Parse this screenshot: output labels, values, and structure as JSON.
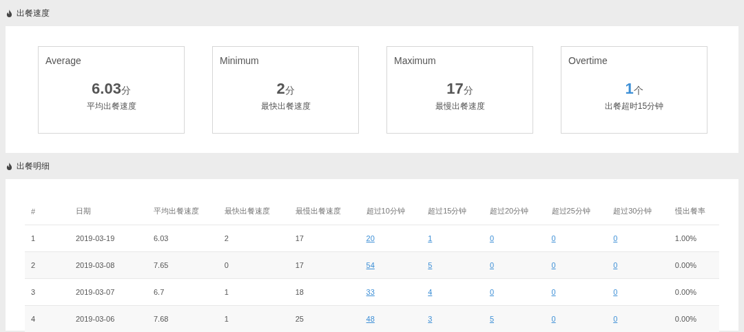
{
  "sections": [
    {
      "title": "出餐速度"
    },
    {
      "title": "出餐明细"
    }
  ],
  "stats": [
    {
      "label": "Average",
      "value": "6.03",
      "unit": "分",
      "caption": "平均出餐速度",
      "highlight": false
    },
    {
      "label": "Minimum",
      "value": "2",
      "unit": "分",
      "caption": "最快出餐速度",
      "highlight": false
    },
    {
      "label": "Maximum",
      "value": "17",
      "unit": "分",
      "caption": "最慢出餐速度",
      "highlight": false
    },
    {
      "label": "Overtime",
      "value": "1",
      "unit": "个",
      "caption": "出餐超时15分钟",
      "highlight": true
    }
  ],
  "table": {
    "columns": [
      "#",
      "日期",
      "平均出餐速度",
      "最快出餐速度",
      "最慢出餐速度",
      "超过10分钟",
      "超过15分钟",
      "超过20分钟",
      "超过25分钟",
      "超过30分钟",
      "慢出餐率"
    ],
    "rows": [
      {
        "index": "1",
        "date": "2019-03-19",
        "avg": "6.03",
        "fastest": "2",
        "slowest": "17",
        "over": [
          "20",
          "1",
          "0",
          "0",
          "0"
        ],
        "rate": "1.00%"
      },
      {
        "index": "2",
        "date": "2019-03-08",
        "avg": "7.65",
        "fastest": "0",
        "slowest": "17",
        "over": [
          "54",
          "5",
          "0",
          "0",
          "0"
        ],
        "rate": "0.00%"
      },
      {
        "index": "3",
        "date": "2019-03-07",
        "avg": "6.7",
        "fastest": "1",
        "slowest": "18",
        "over": [
          "33",
          "4",
          "0",
          "0",
          "0"
        ],
        "rate": "0.00%"
      },
      {
        "index": "4",
        "date": "2019-03-06",
        "avg": "7.68",
        "fastest": "1",
        "slowest": "25",
        "over": [
          "48",
          "3",
          "5",
          "0",
          "0"
        ],
        "rate": "0.00%"
      }
    ]
  }
}
